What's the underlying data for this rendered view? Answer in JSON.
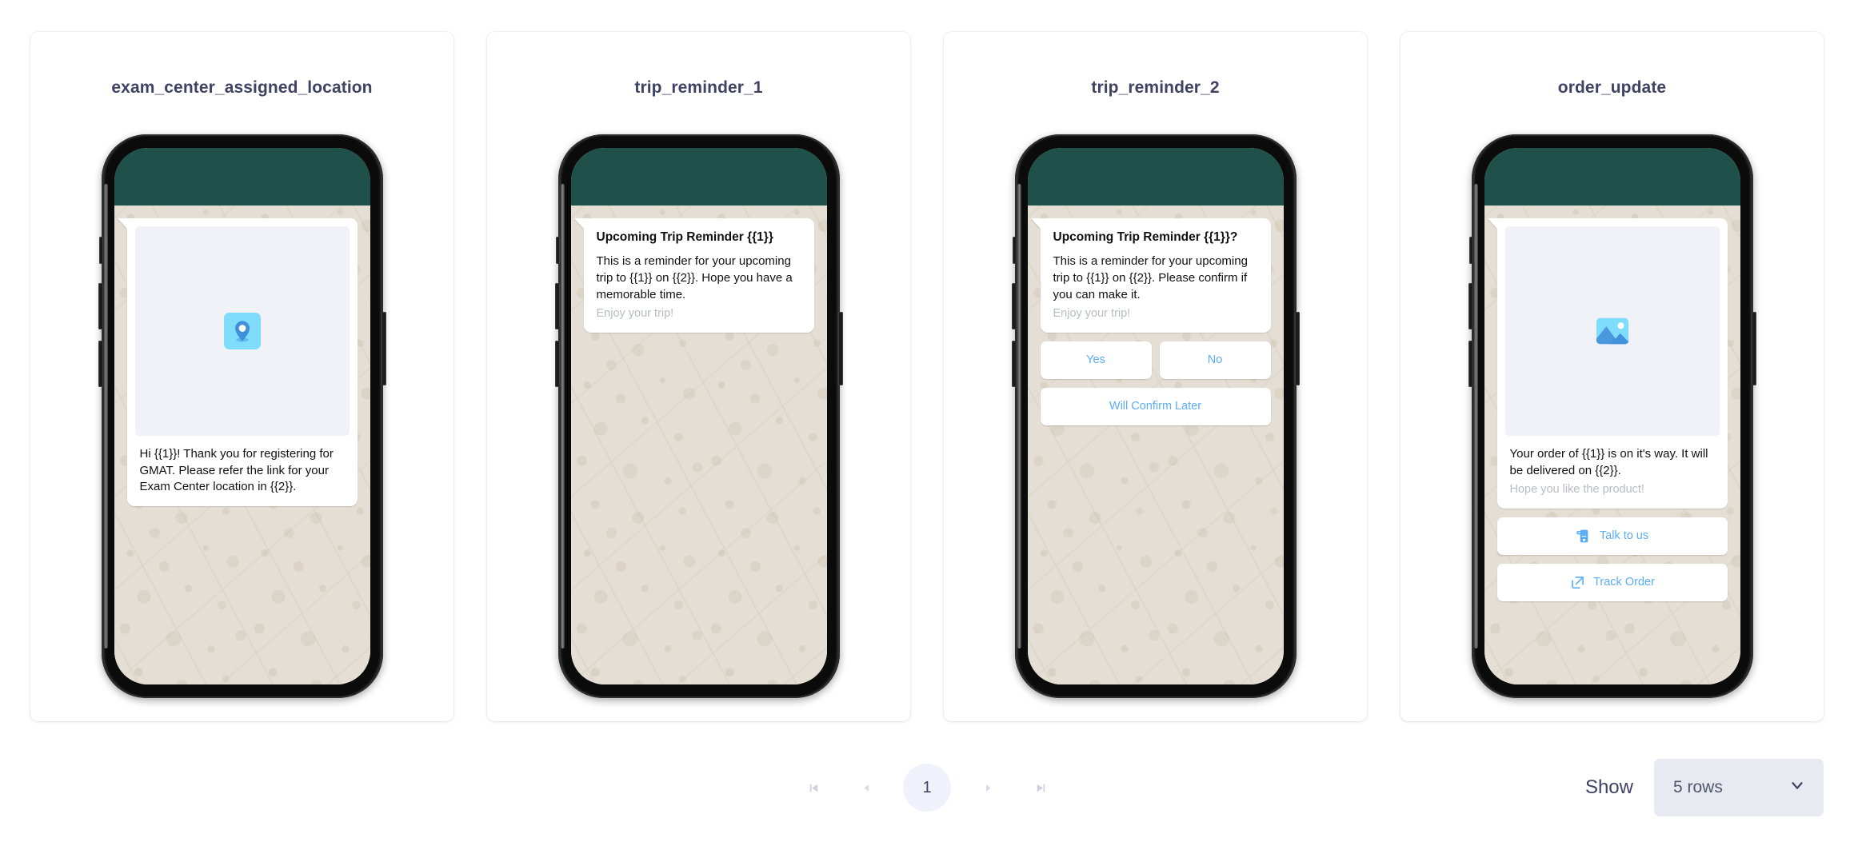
{
  "templates": [
    {
      "title": "exam_center_assigned_location",
      "media_icon": "location-pin-icon",
      "header": "",
      "body": "Hi {{1}}! Thank you for registering for GMAT. Please refer the link for your Exam Center location in {{2}}.",
      "footer": "",
      "buttons": []
    },
    {
      "title": "trip_reminder_1",
      "media_icon": "",
      "header": "Upcoming Trip Reminder {{1}}",
      "body": "This is a reminder for your upcoming trip to {{1}} on {{2}}. Hope you have a memorable time.",
      "footer": "Enjoy your trip!",
      "buttons": []
    },
    {
      "title": "trip_reminder_2",
      "media_icon": "",
      "header": "Upcoming Trip Reminder {{1}}?",
      "body": "This is a reminder for your upcoming trip to {{1}} on {{2}}. Please confirm if you can make it.",
      "footer": "Enjoy your trip!",
      "buttons": [
        {
          "label": "Yes",
          "icon": "",
          "layout": "half"
        },
        {
          "label": "No",
          "icon": "",
          "layout": "half"
        },
        {
          "label": "Will Confirm Later",
          "icon": "",
          "layout": "full"
        }
      ]
    },
    {
      "title": "order_update",
      "media_icon": "image-placeholder-icon",
      "header": "",
      "body": "Your order of {{1}} is on it's way. It will be delivered on {{2}}.",
      "footer": "Hope you like the product!",
      "buttons": [
        {
          "label": "Talk to us",
          "icon": "mobile-phone-icon",
          "layout": "full"
        },
        {
          "label": "Track Order",
          "icon": "external-link-icon",
          "layout": "full"
        }
      ]
    }
  ],
  "footer": {
    "pagination": {
      "first_icon": "first-page-icon",
      "prev_icon": "previous-page-icon",
      "current_page": "1",
      "next_icon": "next-page-icon",
      "last_icon": "last-page-icon"
    },
    "show_label": "Show",
    "rows_value": "5 rows",
    "rows_chevron_icon": "chevron-down-icon"
  },
  "colors": {
    "title": "#3f4263",
    "whatsapp_header": "#1f5049",
    "chat_background": "#e4ded4",
    "button_text": "#5badf5",
    "page_pill": "#eff2fa",
    "select_background": "#e8eaf1"
  }
}
